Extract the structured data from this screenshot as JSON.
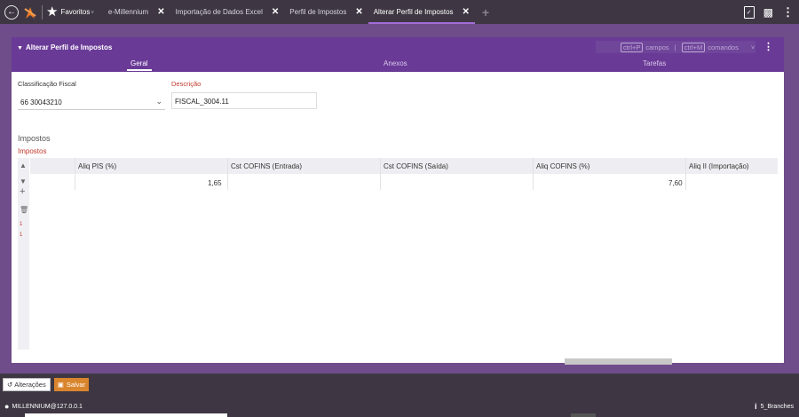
{
  "topbar": {
    "favorites_label": "Favoritos",
    "tabs": [
      {
        "label": "e-Millennium"
      },
      {
        "label": "Importação de Dados Excel"
      },
      {
        "label": "Perfil de Impostos"
      },
      {
        "label": "Alterar Perfil de Impostos"
      }
    ]
  },
  "panel": {
    "title": "Alterar Perfil de Impostos",
    "shortcut1_key": "ctrl+P",
    "shortcut1_label": "campos",
    "shortcut2_key": "ctrl+M",
    "shortcut2_label": "comandos"
  },
  "subtabs": [
    "Geral",
    "Anexos",
    "Tarefas"
  ],
  "form": {
    "classificacao_label": "Classificação Fiscal",
    "classificacao_value": "66 30043210",
    "descricao_label": "Descrição",
    "descricao_value": "FISCAL_3004.11"
  },
  "impostos": {
    "section_title": "Impostos",
    "sub_title": "Impostos",
    "columns": [
      "Aliq PIS (%)",
      "Cst COFINS (Entrada)",
      "Cst COFINS (Saída)",
      "Aliq COFINS (%)",
      "Aliq II (Importação)"
    ],
    "row": {
      "aliq_pis": "1,65",
      "aliq_cofins": "7,60"
    },
    "side_numbers": [
      "1",
      "1"
    ]
  },
  "actions": {
    "alteracoes_label": "Alterações",
    "salvar_label": "Salvar"
  },
  "status": {
    "user": "MILLENNIUM@127.0.0.1",
    "branch": "5_Branches"
  },
  "colors": {
    "accent": "#6a3a97",
    "save": "#d9852d"
  }
}
